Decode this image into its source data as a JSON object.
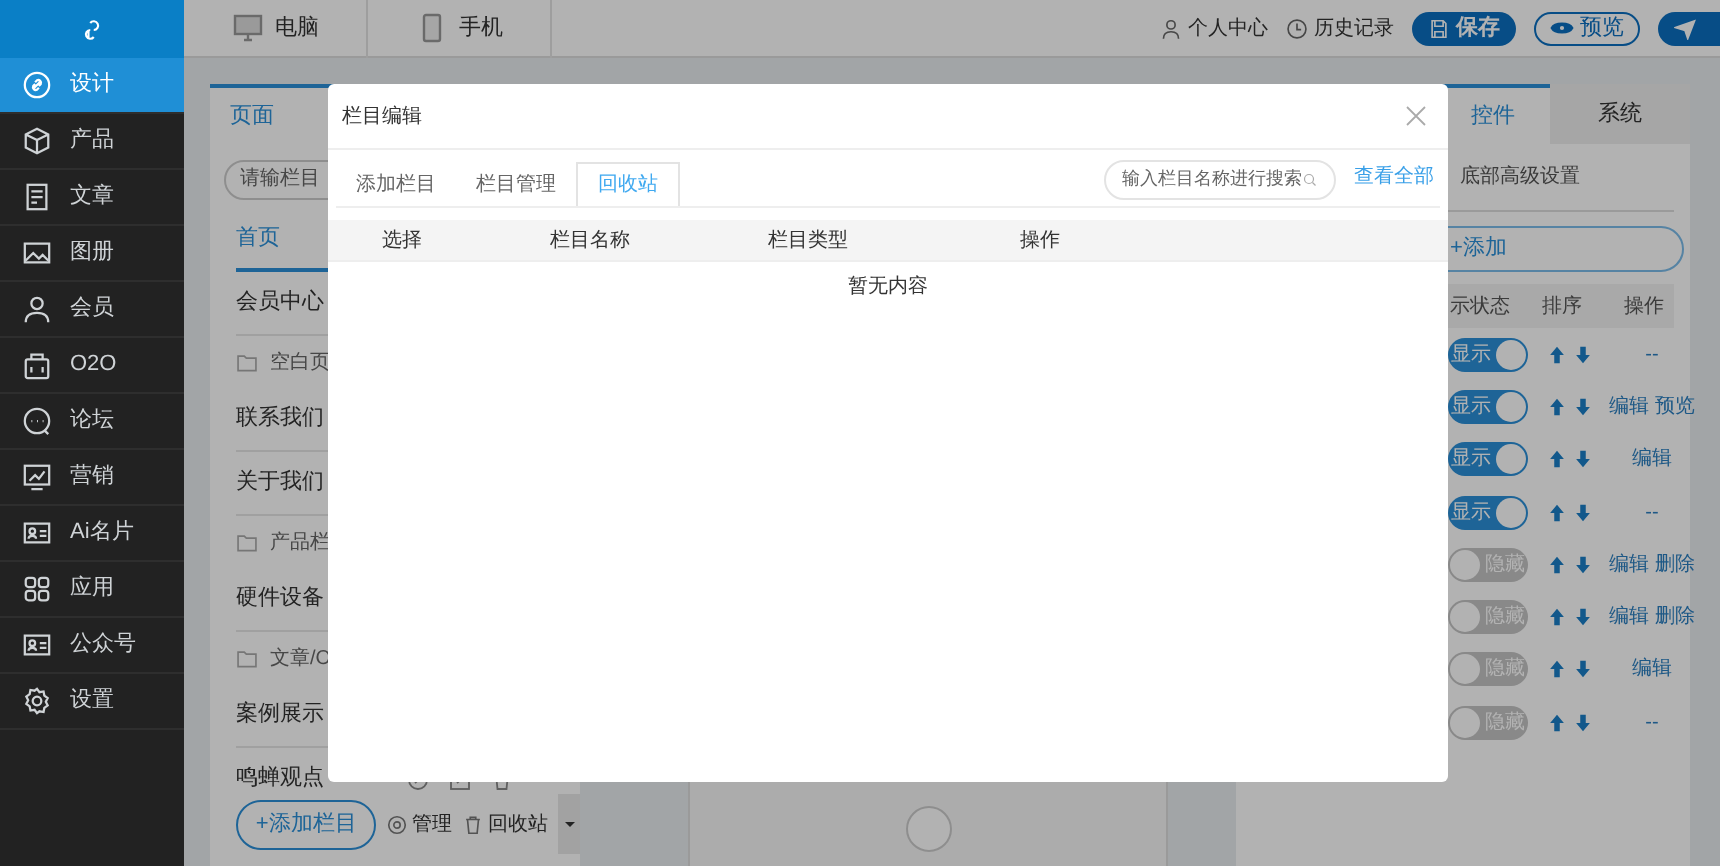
{
  "sidebar": {
    "items": [
      {
        "label": "设计",
        "selected": true
      },
      {
        "label": "产品",
        "selected": false
      },
      {
        "label": "文章",
        "selected": false
      },
      {
        "label": "图册",
        "selected": false
      },
      {
        "label": "会员",
        "selected": false
      },
      {
        "label": "O2O",
        "selected": false
      },
      {
        "label": "论坛",
        "selected": false
      },
      {
        "label": "营销",
        "selected": false
      },
      {
        "label": "Ai名片",
        "selected": false
      },
      {
        "label": "应用",
        "selected": false
      },
      {
        "label": "公众号",
        "selected": false
      },
      {
        "label": "设置",
        "selected": false
      }
    ]
  },
  "top_bar": {
    "device_tabs": [
      {
        "label": "电脑"
      },
      {
        "label": "手机"
      }
    ],
    "links": [
      {
        "label": "个人中心"
      },
      {
        "label": "历史记录"
      }
    ],
    "save_button": "保存",
    "preview_button": "预览"
  },
  "pages_panel": {
    "tab": "页面",
    "search_placeholder": "请输栏目",
    "items": [
      {
        "kind": "page",
        "label": "首页",
        "selected": true
      },
      {
        "kind": "page",
        "label": "会员中心",
        "selected": false
      },
      {
        "kind": "folder",
        "label": "空白页",
        "selected": false
      },
      {
        "kind": "page",
        "label": "联系我们",
        "selected": false
      },
      {
        "kind": "page",
        "label": "关于我们",
        "selected": false
      },
      {
        "kind": "folder",
        "label": "产品栏",
        "selected": false
      },
      {
        "kind": "page",
        "label": "硬件设备",
        "selected": false
      },
      {
        "kind": "folder",
        "label": "文章/O",
        "selected": false
      },
      {
        "kind": "page",
        "label": "案例展示",
        "selected": false
      },
      {
        "kind": "page",
        "label": "鸣蝉观点",
        "selected": false,
        "show_tools": true
      }
    ],
    "add_button": "+添加栏目",
    "manage": "管理",
    "recycle": "回收站"
  },
  "widgets_panel": {
    "tabs": [
      {
        "label": "控件",
        "selected": true
      },
      {
        "label": "系统",
        "selected": false
      }
    ],
    "section": "底部高级设置",
    "add_button": "+添加",
    "columns": [
      "示状态",
      "排序",
      "操作"
    ],
    "rows": [
      {
        "on": true,
        "toggle_label": "显示",
        "actions": [
          "--"
        ]
      },
      {
        "on": true,
        "toggle_label": "显示",
        "actions": [
          "编辑",
          "预览"
        ]
      },
      {
        "on": true,
        "toggle_label": "显示",
        "actions": [
          "编辑"
        ]
      },
      {
        "on": true,
        "toggle_label": "显示",
        "actions": [
          "--"
        ]
      },
      {
        "on": false,
        "toggle_label": "隐藏",
        "actions": [
          "编辑",
          "删除"
        ]
      },
      {
        "on": false,
        "toggle_label": "隐藏",
        "actions": [
          "编辑",
          "删除"
        ]
      },
      {
        "on": false,
        "toggle_label": "隐藏",
        "actions": [
          "编辑"
        ]
      },
      {
        "on": false,
        "toggle_label": "隐藏",
        "actions": [
          "--"
        ]
      }
    ]
  },
  "modal": {
    "title": "栏目编辑",
    "tabs": [
      {
        "label": "添加栏目",
        "selected": false
      },
      {
        "label": "栏目管理",
        "selected": false
      },
      {
        "label": "回收站",
        "selected": true
      }
    ],
    "search_placeholder": "输入栏目名称进行搜索",
    "view_all": "查看全部",
    "columns": [
      "选择",
      "栏目名称",
      "栏目类型",
      "操作"
    ],
    "empty_text": "暂无内容"
  }
}
